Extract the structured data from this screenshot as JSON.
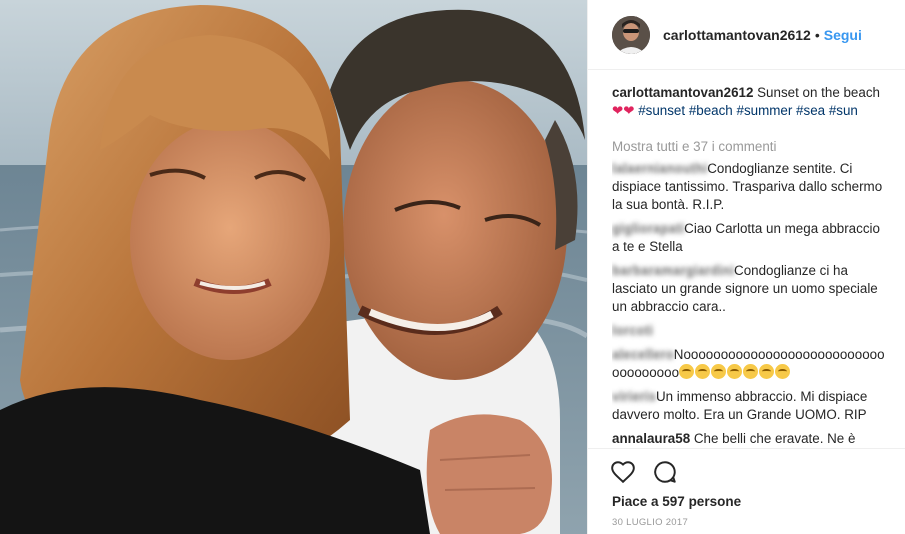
{
  "post": {
    "photo_alt": "Selfie of a woman and a man on the beach at sunset",
    "header": {
      "username": "carlottamantovan2612",
      "separator": "•",
      "follow_label": "Segui"
    },
    "caption": {
      "username": "carlottamantovan2612",
      "text": " Sunset on the beach ",
      "hearts": "❤❤",
      "hashtags": [
        "#sunset",
        "#beach",
        "#summer",
        "#sea",
        "#sun"
      ]
    },
    "show_all_comments": "Mostra tutti e 37 i commenti",
    "comments": [
      {
        "username": "lalaernianouthi",
        "text": "Condoglianze sentite. Ci dispiace tantissimo. Traspariva dallo schermo la sua bontà. R.I.P."
      },
      {
        "username": "gigliorapati",
        "text": "Ciao Carlotta un mega abbraccio a te e Stella"
      },
      {
        "username": "barbaramargiardini",
        "text": "Condoglianze ci ha lasciato un grande signore un uomo speciale un abbraccio cara.."
      },
      {
        "username": "lorcoti",
        "text": ""
      },
      {
        "username": "alecellero",
        "text": "Noooooooooooooooooooooooooooooooooooo"
      },
      {
        "username": "virieris",
        "text": "Un immenso abbraccio. Mi dispiace davvero molto. Era un Grande UOMO. RIP"
      },
      {
        "username": "annalaura58",
        "text": "Che belli che eravate. Ne è"
      }
    ],
    "comment_emoji_count": 7,
    "emoji_icon": "crying-face-icon",
    "actions": {
      "like_icon": "heart-outline-icon",
      "comment_icon": "speech-bubble-icon"
    },
    "likes_text": "Piace a 597 persone",
    "date": "30 LUGLIO 2017"
  },
  "colors": {
    "link": "#003569",
    "follow": "#3897f0",
    "muted": "#999999",
    "heart": "#e0245e"
  }
}
